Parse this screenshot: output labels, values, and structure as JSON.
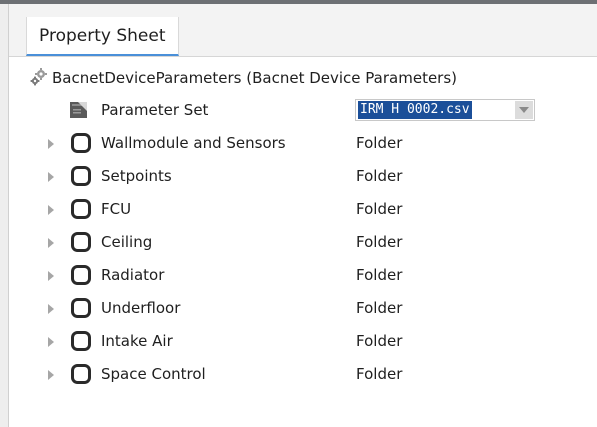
{
  "tab": {
    "label": "Property Sheet"
  },
  "header": {
    "label": "BacnetDeviceParameters  (Bacnet Device Parameters)"
  },
  "parameter_set": {
    "label": "Parameter Set",
    "selected_value": "IRM H 0002.csv"
  },
  "rows": [
    {
      "name": "Wallmodule and Sensors",
      "value": "Folder"
    },
    {
      "name": "Setpoints",
      "value": "Folder"
    },
    {
      "name": "FCU",
      "value": "Folder"
    },
    {
      "name": "Ceiling",
      "value": "Folder"
    },
    {
      "name": "Radiator",
      "value": "Folder"
    },
    {
      "name": "Underfloor",
      "value": "Folder"
    },
    {
      "name": "Intake Air",
      "value": "Folder"
    },
    {
      "name": "Space Control",
      "value": "Folder"
    }
  ],
  "colors": {
    "selection": "#1b4f99",
    "tab_underline": "#4a90d9"
  }
}
